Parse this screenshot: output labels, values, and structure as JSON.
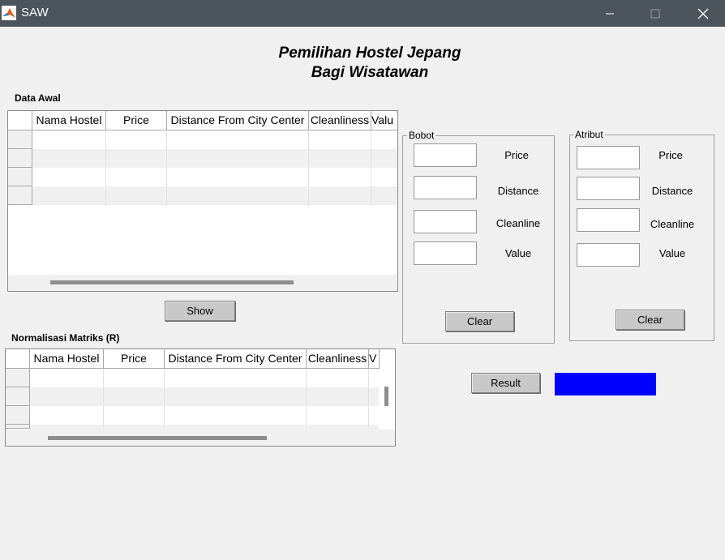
{
  "window": {
    "title": "SAW",
    "icon": "matlab-icon"
  },
  "heading": {
    "line1": "Pemilihan Hostel Jepang",
    "line2": "Bagi Wisatawan"
  },
  "data_awal": {
    "label": "Data Awal",
    "columns": [
      "Nama Hostel",
      "Price",
      "Distance From City Center",
      "Cleanliness",
      "Valu"
    ]
  },
  "show_button": "Show",
  "normalisasi": {
    "label": "Normalisasi Matriks (R)",
    "columns": [
      "Nama Hostel",
      "Price",
      "Distance From City Center",
      "Cleanliness",
      "V"
    ]
  },
  "bobot": {
    "title": "Bobot",
    "labels": [
      "Price",
      "Distance",
      "Cleanline",
      "Value"
    ],
    "values": [
      "",
      "",
      "",
      ""
    ],
    "clear": "Clear"
  },
  "atribut": {
    "title": "Atribut",
    "labels": [
      "Price",
      "Distance",
      "Cleanline",
      "Value"
    ],
    "values": [
      "",
      "",
      "",
      ""
    ],
    "clear": "Clear"
  },
  "result_button": "Result",
  "result_color": "#0000ff"
}
